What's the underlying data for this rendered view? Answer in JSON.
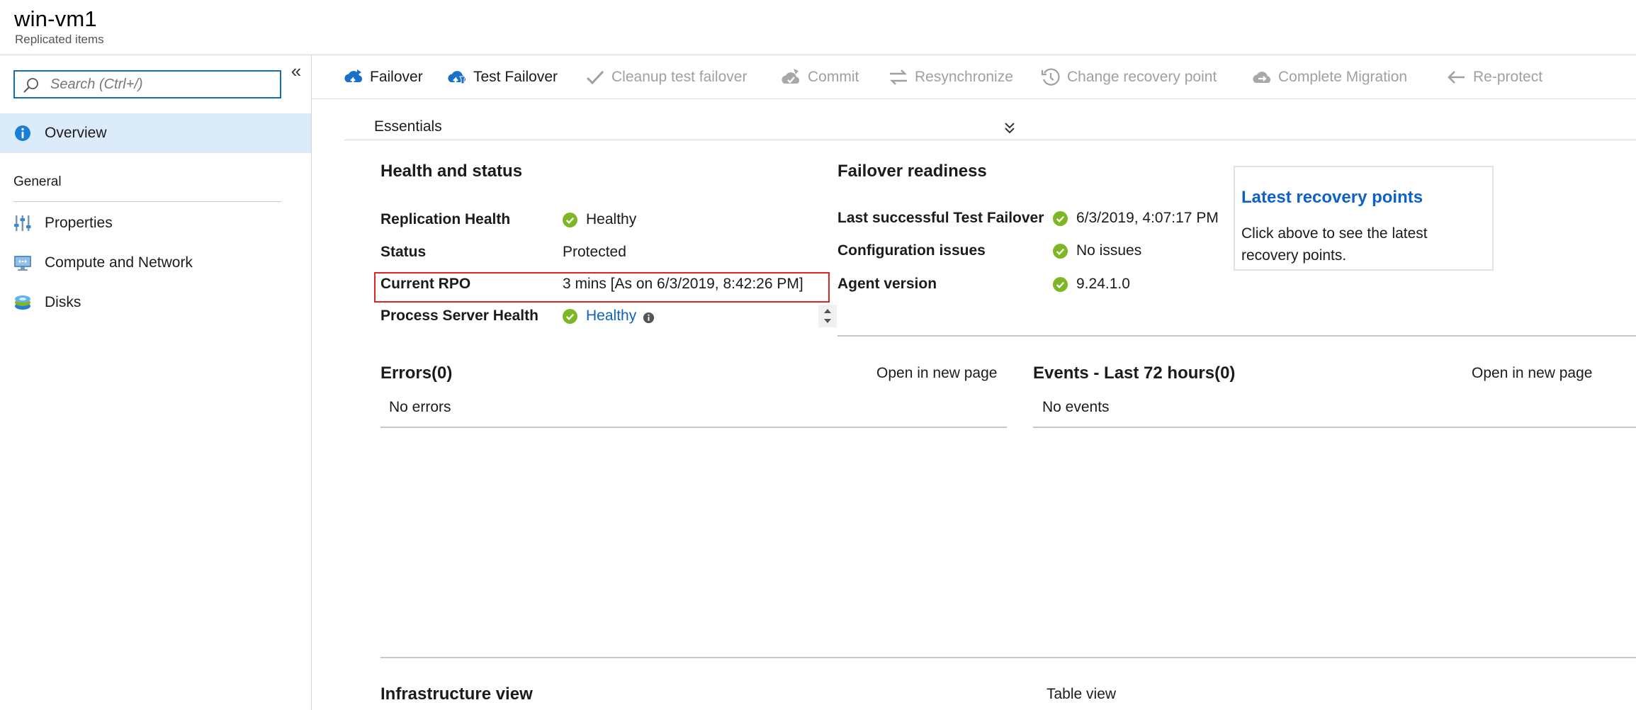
{
  "header": {
    "title": "win-vm1",
    "subtitle": "Replicated items"
  },
  "sidebar": {
    "search_placeholder": "Search (Ctrl+/)",
    "collapse_glyph": "«",
    "overview_label": "Overview",
    "section_general": "General",
    "items": [
      {
        "label": "Properties",
        "icon": "properties-icon"
      },
      {
        "label": "Compute and Network",
        "icon": "compute-network-icon"
      },
      {
        "label": "Disks",
        "icon": "disks-icon"
      }
    ]
  },
  "toolbar": {
    "failover": "Failover",
    "test_failover": "Test Failover",
    "cleanup": "Cleanup test failover",
    "commit": "Commit",
    "resync": "Resynchronize",
    "change_rp": "Change recovery point",
    "complete_migration": "Complete Migration",
    "reprotect": "Re-protect"
  },
  "essentials": {
    "title": "Essentials"
  },
  "health": {
    "title": "Health and status",
    "replication_health_label": "Replication Health",
    "replication_health_value": "Healthy",
    "status_label": "Status",
    "status_value": "Protected",
    "rpo_label": "Current RPO",
    "rpo_value": "3 mins [As on 6/3/2019, 8:42:26 PM]",
    "ps_health_label": "Process Server Health",
    "ps_health_value": "Healthy"
  },
  "failover": {
    "title": "Failover readiness",
    "last_tf_label": "Last successful Test Failover",
    "last_tf_value": "6/3/2019, 4:07:17 PM",
    "config_label": "Configuration issues",
    "config_value": "No issues",
    "agent_label": "Agent version",
    "agent_value": "9.24.1.0"
  },
  "recovery_card": {
    "title": "Latest recovery points",
    "text": "Click above to see the latest recovery points."
  },
  "errors": {
    "title": "Errors(0)",
    "link": "Open in new page",
    "empty": "No errors"
  },
  "events": {
    "title": "Events - Last 72 hours(0)",
    "link": "Open in new page",
    "empty": "No events"
  },
  "infrastructure": {
    "title": "Infrastructure view",
    "link": "Table view"
  },
  "colors": {
    "accent": "#0d62c4",
    "ok_green": "#7db724",
    "highlight_red": "#e02424",
    "active_nav": "#dcebfa",
    "disabled": "#a0a0a0"
  }
}
